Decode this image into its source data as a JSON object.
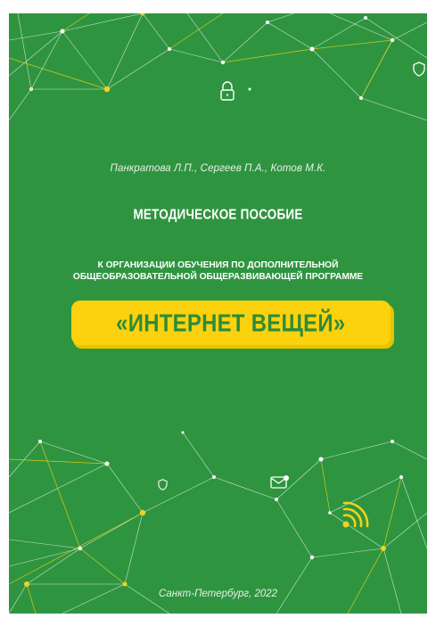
{
  "cover": {
    "authors": "Панкратова Л.П., Сергеев П.А., Котов М.К.",
    "doc_type": "МЕТОДИЧЕСКОЕ ПОСОБИЕ",
    "subtitle_line1": "К ОРГАНИЗАЦИИ ОБУЧЕНИЯ ПО ДОПОЛНИТЕЛЬНОЙ",
    "subtitle_line2": "ОБЩЕОБРАЗОВАТЕЛЬНОЙ ОБЩЕРАЗВИВАЮЩЕЙ ПРОГРАММЕ",
    "program_title": "«ИНТЕРНЕТ ВЕЩЕЙ»",
    "footer": "Санкт-Петербург, 2022"
  },
  "colors": {
    "background": "#2f9440",
    "banner": "#fbd20d",
    "banner_text": "#2e8b3a",
    "network_lines": "#ffffff",
    "network_accent": "#f2d21a"
  },
  "icons": [
    "lock-icon",
    "shield-icon",
    "envelope-icon",
    "wifi-signal-icon",
    "network-graph-decoration"
  ]
}
